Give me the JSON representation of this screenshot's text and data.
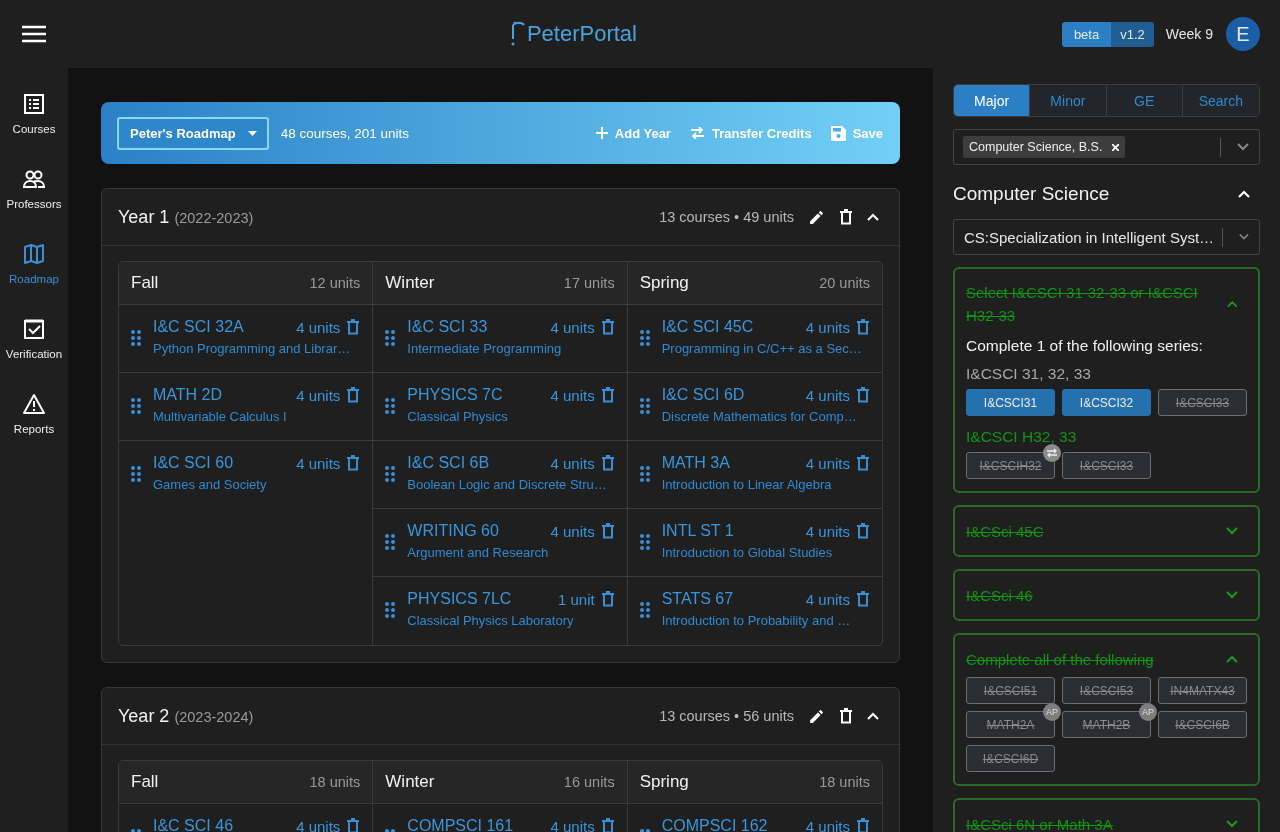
{
  "header": {
    "logo": "PeterPortal",
    "badge": "beta",
    "version": "v1.2",
    "week": "Week 9",
    "avatar": "E"
  },
  "nav": [
    {
      "kind": "list",
      "label": "Courses",
      "selected": false
    },
    {
      "kind": "people",
      "label": "Professors",
      "selected": false
    },
    {
      "kind": "map",
      "label": "Roadmap",
      "selected": true
    },
    {
      "kind": "check",
      "label": "Verification",
      "selected": false
    },
    {
      "kind": "warning",
      "label": "Reports",
      "selected": false
    }
  ],
  "roadmap": {
    "name": "Peter's Roadmap",
    "summary": "48 courses, 201 units",
    "actions": [
      {
        "kind": "add",
        "label": "Add Year"
      },
      {
        "kind": "transfer",
        "label": "Transfer Credits"
      },
      {
        "kind": "save",
        "label": "Save"
      }
    ]
  },
  "years": [
    {
      "title": "Year 1",
      "range": "(2022-2023)",
      "summary": "13 courses • 49 units",
      "expanded": true,
      "quarters": [
        {
          "name": "Fall",
          "units": "12 units",
          "courses": [
            {
              "code": "I&C SCI 32A",
              "units": "4 units",
              "title": "Python Programming and Librar…"
            },
            {
              "code": "MATH 2D",
              "units": "4 units",
              "title": "Multivariable Calculus I"
            },
            {
              "code": "I&C SCI 60",
              "units": "4 units",
              "title": "Games and Society"
            }
          ]
        },
        {
          "name": "Winter",
          "units": "17 units",
          "courses": [
            {
              "code": "I&C SCI 33",
              "units": "4 units",
              "title": "Intermediate Programming"
            },
            {
              "code": "PHYSICS 7C",
              "units": "4 units",
              "title": "Classical Physics"
            },
            {
              "code": "I&C SCI 6B",
              "units": "4 units",
              "title": "Boolean Logic and Discrete Stru…"
            },
            {
              "code": "WRITING 60",
              "units": "4 units",
              "title": "Argument and Research"
            },
            {
              "code": "PHYSICS 7LC",
              "units": "1 unit",
              "title": "Classical Physics Laboratory"
            }
          ]
        },
        {
          "name": "Spring",
          "units": "20 units",
          "courses": [
            {
              "code": "I&C SCI 45C",
              "units": "4 units",
              "title": "Programming in C/C++ as a Sec…"
            },
            {
              "code": "I&C SCI 6D",
              "units": "4 units",
              "title": "Discrete Mathematics for Comp…"
            },
            {
              "code": "MATH 3A",
              "units": "4 units",
              "title": "Introduction to Linear Algebra"
            },
            {
              "code": "INTL ST 1",
              "units": "4 units",
              "title": "Introduction to Global Studies"
            },
            {
              "code": "STATS 67",
              "units": "4 units",
              "title": "Introduction to Probability and …"
            }
          ]
        }
      ]
    },
    {
      "title": "Year 2",
      "range": "(2023-2024)",
      "summary": "13 courses • 56 units",
      "expanded": true,
      "quarters": [
        {
          "name": "Fall",
          "units": "18 units",
          "courses": [
            {
              "code": "I&C SCI 46",
              "units": "4 units"
            }
          ]
        },
        {
          "name": "Winter",
          "units": "16 units",
          "courses": [
            {
              "code": "COMPSCI 161",
              "units": "4 units"
            }
          ]
        },
        {
          "name": "Spring",
          "units": "18 units",
          "courses": [
            {
              "code": "COMPSCI 162",
              "units": "4 units"
            }
          ]
        }
      ]
    }
  ],
  "requirements": {
    "tabs": [
      {
        "label": "Major",
        "selected": true
      },
      {
        "label": "Minor",
        "selected": false
      },
      {
        "label": "GE",
        "selected": false
      },
      {
        "label": "Search",
        "selected": false
      }
    ],
    "majors": [
      "Computer Science, B.S."
    ],
    "section": {
      "title": "Computer Science",
      "expanded": true
    },
    "specialization": "CS:Specialization in Intelligent Syst…",
    "items": [
      {
        "title": "Select I&CSCI 31-32-33 or I&CSCI H32-33",
        "completed": true,
        "expanded": true,
        "description": "Complete 1 of the following series:",
        "groups": [
          {
            "label": "I&CSCI 31, 32, 33",
            "completed": false,
            "courses": [
              {
                "label": "I&CSCI31",
                "completed": false
              },
              {
                "label": "I&CSCI32",
                "completed": false
              },
              {
                "label": "I&CSCI33",
                "completed": true
              }
            ]
          },
          {
            "label": "I&CSCI H32, 33",
            "completed": true,
            "courses": [
              {
                "label": "I&CSCIH32",
                "completed": true,
                "transferred": true
              },
              {
                "label": "I&CSCI33",
                "completed": true
              }
            ]
          }
        ]
      },
      {
        "title": "I&CSci 45C",
        "completed": true,
        "expanded": false
      },
      {
        "title": "I&CSci 46",
        "completed": true,
        "expanded": false
      },
      {
        "title": "Complete all of the following",
        "completed": true,
        "expanded": true,
        "groups": [
          {
            "courses": [
              {
                "label": "I&CSCI51",
                "completed": true
              },
              {
                "label": "I&CSCI53",
                "completed": true
              },
              {
                "label": "IN4MATX43",
                "completed": true
              },
              {
                "label": "MATH2A",
                "completed": true,
                "badge": "AP"
              },
              {
                "label": "MATH2B",
                "completed": true,
                "badge": "AP"
              },
              {
                "label": "I&CSCI6B",
                "completed": true
              },
              {
                "label": "I&CSCI6D",
                "completed": true
              }
            ]
          }
        ]
      },
      {
        "title": "I&CSci 6N or Math 3A",
        "completed": true,
        "expanded": false
      }
    ]
  }
}
